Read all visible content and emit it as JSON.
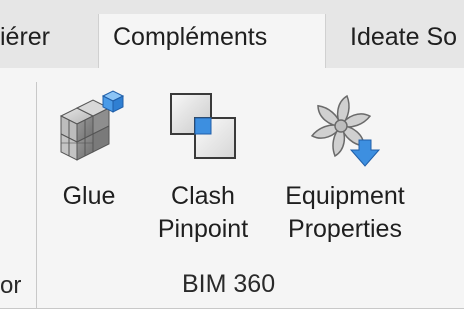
{
  "tabs": {
    "left_partial": "iérer",
    "active": "Compléments",
    "right_partial": "Ideate So"
  },
  "panel": {
    "left_partial_label": "or",
    "label": "BIM 360"
  },
  "tools": {
    "glue": {
      "label": "Glue",
      "icon": "cubes-icon"
    },
    "clash": {
      "line1": "Clash",
      "line2": "Pinpoint",
      "icon": "overlapping-squares-icon"
    },
    "equipment": {
      "line1": "Equipment",
      "line2": "Properties",
      "icon": "fan-icon"
    }
  },
  "colors": {
    "tab_strip": "#e6e6e6",
    "ribbon": "#f5f5f5",
    "accent_blue": "#3d8fe0"
  }
}
